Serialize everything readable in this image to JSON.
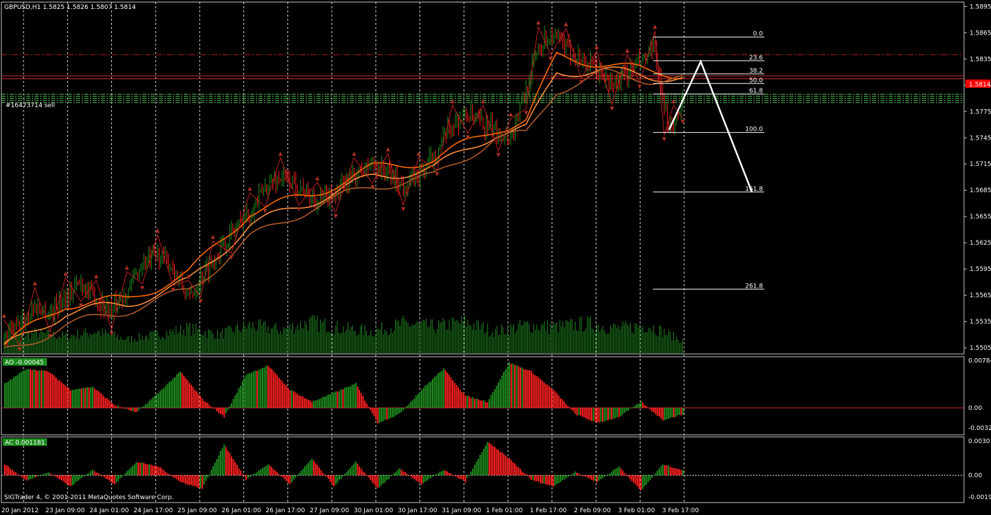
{
  "symbol_header": "GBPUSD,H1  1.5825 1.5826 1.5807 1.5814",
  "order_label": "#16473714 sell",
  "current_price_label": "1.5814",
  "copyright": "SIGTrader 4, © 2001-2011 MetaQuotes Software Corp.",
  "colors": {
    "background": "#000000",
    "bull": "#1e8c1e",
    "bear": "#ff2020",
    "ma_fast": "#ff6a00",
    "ma_mid": "#ff8c3a",
    "ma_slow": "#b05a28",
    "fractal": "#b03020",
    "zigzag": "#c02020",
    "grid": "#ffffff",
    "order_line": "#50c050",
    "resistance_line": "#c02020",
    "fib": "#ffffff",
    "label_bg": "#1a8a1a"
  },
  "chart_data": [
    {
      "type": "candlestick",
      "title": "GBPUSD,H1",
      "y_ticks": [
        "1.5895",
        "1.5865",
        "1.5835",
        "1.5805",
        "1.5775",
        "1.5745",
        "1.5715",
        "1.5685",
        "1.5655",
        "1.5625",
        "1.5595",
        "1.5565",
        "1.5535",
        "1.5505"
      ],
      "ylim": [
        1.5498,
        1.59
      ],
      "x_ticks": [
        "20 Jan 2012",
        "23 Jan 09:00",
        "24 Jan 01:00",
        "24 Jan 17:00",
        "25 Jan 09:00",
        "26 Jan 01:00",
        "26 Jan 17:00",
        "27 Jan 09:00",
        "30 Jan 01:00",
        "30 Jan 17:00",
        "31 Jan 09:00",
        "1 Feb 01:00",
        "1 Feb 17:00",
        "2 Feb 09:00",
        "3 Feb 01:00",
        "3 Feb 17:00"
      ],
      "grid": "vertical dashed",
      "close_path": [
        [
          0,
          1.5515
        ],
        [
          10,
          1.553
        ],
        [
          20,
          1.5552
        ],
        [
          30,
          1.5545
        ],
        [
          40,
          1.5563
        ],
        [
          50,
          1.558
        ],
        [
          60,
          1.556
        ],
        [
          70,
          1.5548
        ],
        [
          80,
          1.557
        ],
        [
          90,
          1.56
        ],
        [
          100,
          1.5612
        ],
        [
          110,
          1.5598
        ],
        [
          120,
          1.556
        ],
        [
          128,
          1.5585
        ],
        [
          136,
          1.5605
        ],
        [
          148,
          1.5635
        ],
        [
          160,
          1.566
        ],
        [
          170,
          1.5688
        ],
        [
          180,
          1.57
        ],
        [
          192,
          1.569
        ],
        [
          204,
          1.5672
        ],
        [
          216,
          1.5682
        ],
        [
          228,
          1.57
        ],
        [
          240,
          1.5715
        ],
        [
          250,
          1.5705
        ],
        [
          260,
          1.569
        ],
        [
          270,
          1.57
        ],
        [
          282,
          1.573
        ],
        [
          292,
          1.576
        ],
        [
          302,
          1.5772
        ],
        [
          312,
          1.576
        ],
        [
          322,
          1.5752
        ],
        [
          330,
          1.5745
        ],
        [
          340,
          1.58
        ],
        [
          348,
          1.585
        ],
        [
          356,
          1.5862
        ],
        [
          366,
          1.5848
        ],
        [
          376,
          1.5835
        ],
        [
          386,
          1.5822
        ],
        [
          396,
          1.5805
        ],
        [
          406,
          1.5818
        ],
        [
          414,
          1.583
        ],
        [
          424,
          1.5845
        ],
        [
          430,
          1.577
        ],
        [
          436,
          1.576
        ],
        [
          442,
          1.579
        ]
      ],
      "series": [
        {
          "name": "",
          "path": [
            [
              0,
              1.5508
            ],
            [
              40,
              1.5555
            ],
            [
              80,
              1.556
            ],
            [
              120,
              1.559
            ],
            [
              160,
              1.566
            ],
            [
              200,
              1.568
            ],
            [
              240,
              1.571
            ],
            [
              280,
              1.572
            ],
            [
              320,
              1.5755
            ],
            [
              340,
              1.5765
            ],
            [
              360,
              1.5838
            ],
            [
              390,
              1.583
            ],
            [
              420,
              1.582
            ],
            [
              442,
              1.5818
            ]
          ]
        },
        {
          "name": "",
          "path": [
            [
              0,
              1.5505
            ],
            [
              40,
              1.5545
            ],
            [
              80,
              1.5555
            ],
            [
              120,
              1.558
            ],
            [
              160,
              1.5645
            ],
            [
              200,
              1.5672
            ],
            [
              240,
              1.57
            ],
            [
              280,
              1.571
            ],
            [
              320,
              1.575
            ],
            [
              340,
              1.5755
            ],
            [
              360,
              1.582
            ],
            [
              390,
              1.5822
            ],
            [
              420,
              1.5815
            ],
            [
              442,
              1.5815
            ]
          ]
        },
        {
          "name": "",
          "path": [
            [
              0,
              1.55
            ],
            [
              40,
              1.553
            ],
            [
              80,
              1.5548
            ],
            [
              120,
              1.557
            ],
            [
              160,
              1.563
            ],
            [
              200,
              1.5665
            ],
            [
              240,
              1.569
            ],
            [
              280,
              1.57
            ],
            [
              320,
              1.5745
            ],
            [
              340,
              1.5748
            ],
            [
              360,
              1.58
            ],
            [
              390,
              1.5818
            ],
            [
              420,
              1.5812
            ],
            [
              442,
              1.5812
            ]
          ]
        }
      ],
      "volume_peaks": [
        [
          0,
          0.5
        ],
        [
          20,
          0.65
        ],
        [
          40,
          0.55
        ],
        [
          60,
          0.7
        ],
        [
          80,
          0.45
        ],
        [
          100,
          0.6
        ],
        [
          120,
          0.8
        ],
        [
          140,
          0.6
        ],
        [
          160,
          0.9
        ],
        [
          180,
          0.75
        ],
        [
          200,
          1.0
        ],
        [
          220,
          0.8
        ],
        [
          240,
          0.7
        ],
        [
          260,
          0.95
        ],
        [
          280,
          0.85
        ],
        [
          300,
          1.0
        ],
        [
          320,
          0.7
        ],
        [
          340,
          0.9
        ],
        [
          360,
          0.85
        ],
        [
          380,
          0.95
        ],
        [
          400,
          0.8
        ],
        [
          420,
          0.9
        ],
        [
          442,
          0.4
        ]
      ],
      "order_price": 1.579,
      "resistance_price": 1.584,
      "current_price": 1.5814,
      "fibonacci": {
        "levels": [
          {
            "label": "0.0",
            "price": 1.586
          },
          {
            "label": "23.6",
            "price": 1.5833
          },
          {
            "label": "38.2",
            "price": 1.5818
          },
          {
            "label": "50.0",
            "price": 1.5807
          },
          {
            "label": "61.8",
            "price": 1.5795
          },
          {
            "label": "100.0",
            "price": 1.5751
          },
          {
            "label": "161.8",
            "price": 1.5683
          },
          {
            "label": "261.8",
            "price": 1.5572
          }
        ]
      }
    },
    {
      "type": "bar",
      "title": "AO -0.00045",
      "y_ticks": [
        "0.00784",
        "0.00",
        "-0.00329"
      ],
      "ylim": [
        -0.004,
        0.008
      ],
      "zero": 0.0,
      "shape": [
        [
          0,
          0.004
        ],
        [
          12,
          0.0065
        ],
        [
          24,
          0.006
        ],
        [
          36,
          0.003
        ],
        [
          48,
          0.0035
        ],
        [
          60,
          0.0005
        ],
        [
          72,
          -0.0008
        ],
        [
          84,
          0.0025
        ],
        [
          96,
          0.006
        ],
        [
          108,
          0.0015
        ],
        [
          120,
          -0.0015
        ],
        [
          132,
          0.0055
        ],
        [
          144,
          0.007
        ],
        [
          156,
          0.003
        ],
        [
          168,
          0.001
        ],
        [
          180,
          0.0025
        ],
        [
          192,
          0.004
        ],
        [
          204,
          -0.0025
        ],
        [
          216,
          -0.001
        ],
        [
          228,
          0.003
        ],
        [
          240,
          0.0065
        ],
        [
          252,
          0.002
        ],
        [
          264,
          0.001
        ],
        [
          276,
          0.0075
        ],
        [
          288,
          0.006
        ],
        [
          300,
          0.003
        ],
        [
          312,
          -0.001
        ],
        [
          324,
          -0.0025
        ],
        [
          336,
          -0.0015
        ],
        [
          348,
          0.001
        ],
        [
          360,
          -0.002
        ],
        [
          372,
          -0.001
        ]
      ]
    },
    {
      "type": "bar",
      "title": "AC 0.001181",
      "y_ticks": [
        "0.00307",
        "0.00",
        "-0.00194"
      ],
      "ylim": [
        -0.0022,
        0.0032
      ],
      "zero": 0.0,
      "shape": [
        [
          0,
          0.001
        ],
        [
          12,
          -0.0005
        ],
        [
          24,
          0.0003
        ],
        [
          36,
          -0.001
        ],
        [
          48,
          0.0005
        ],
        [
          60,
          -0.0008
        ],
        [
          72,
          0.0012
        ],
        [
          84,
          0.0008
        ],
        [
          96,
          -0.0006
        ],
        [
          108,
          -0.0012
        ],
        [
          120,
          0.0028
        ],
        [
          132,
          -0.0004
        ],
        [
          144,
          0.001
        ],
        [
          156,
          -0.0008
        ],
        [
          168,
          0.0015
        ],
        [
          180,
          -0.001
        ],
        [
          192,
          0.0012
        ],
        [
          204,
          -0.0012
        ],
        [
          216,
          0.0006
        ],
        [
          228,
          -0.0008
        ],
        [
          240,
          0.0005
        ],
        [
          252,
          -0.0006
        ],
        [
          264,
          0.003
        ],
        [
          276,
          0.0015
        ],
        [
          288,
          -0.0004
        ],
        [
          300,
          -0.001
        ],
        [
          312,
          0.0003
        ],
        [
          324,
          -0.0006
        ],
        [
          336,
          0.0008
        ],
        [
          348,
          -0.0014
        ],
        [
          360,
          0.001
        ],
        [
          372,
          0.0004
        ]
      ]
    }
  ]
}
